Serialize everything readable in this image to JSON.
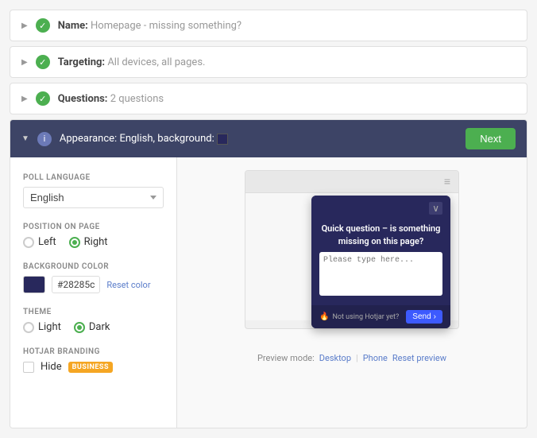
{
  "sections": [
    {
      "id": "name",
      "label": "Name:",
      "value": "Homepage - missing something?",
      "status": "complete"
    },
    {
      "id": "targeting",
      "label": "Targeting:",
      "value": "All devices, all pages.",
      "status": "complete"
    },
    {
      "id": "questions",
      "label": "Questions:",
      "value": "2 questions",
      "status": "complete"
    }
  ],
  "appearance": {
    "header_label": "Appearance:",
    "header_suffix": "English, background:",
    "next_button": "Next",
    "controls": {
      "poll_language_label": "POLL LANGUAGE",
      "poll_language_value": "English",
      "position_label": "POSITION ON PAGE",
      "position_left": "Left",
      "position_right": "Right",
      "position_selected": "Right",
      "bg_color_label": "BACKGROUND COLOR",
      "bg_color_value": "#28285c",
      "reset_color_label": "Reset color",
      "theme_label": "THEME",
      "theme_light": "Light",
      "theme_dark": "Dark",
      "theme_selected": "Dark",
      "hotjar_branding_label": "HOTJAR BRANDING",
      "hide_label": "Hide",
      "business_badge": "BUSINESS"
    },
    "preview": {
      "poll_question": "Quick question – is something missing on this page?",
      "poll_placeholder": "Please type here...",
      "branding_text": "Not using Hotjar yet?",
      "send_button": "Send",
      "mode_label": "Preview mode:",
      "desktop_label": "Desktop",
      "phone_label": "Phone",
      "reset_preview_label": "Reset preview"
    }
  }
}
